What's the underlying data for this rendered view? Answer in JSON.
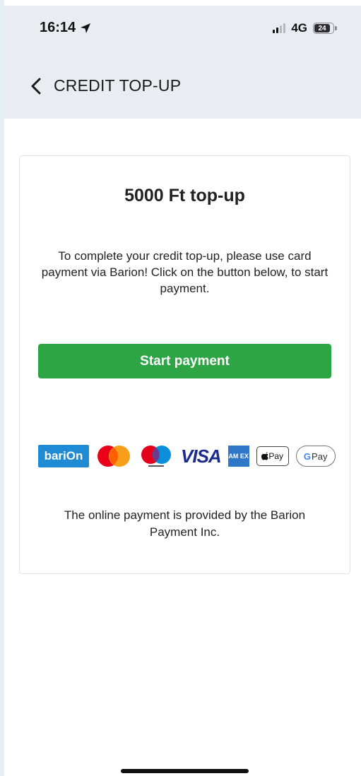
{
  "status_bar": {
    "time": "16:14",
    "network": "4G",
    "battery_level": "24"
  },
  "navbar": {
    "title": "CREDIT TOP-UP"
  },
  "card": {
    "amount_title": "5000 Ft top-up",
    "instructions": "To complete your credit top-up, please use card payment via Barion! Click on the button below, to start payment.",
    "button_label": "Start payment",
    "provider_text": "The online payment is provided by the Barion Payment Inc."
  },
  "payment_logos": {
    "barion": "bariOn",
    "visa": "VISA",
    "amex": "AM EX",
    "applepay": "Pay",
    "gpay": "Pay",
    "gpay_g": "G"
  },
  "colors": {
    "accent_green": "#2ea545",
    "barion_blue": "#1e8bd4",
    "header_bg": "#e9edf1"
  }
}
